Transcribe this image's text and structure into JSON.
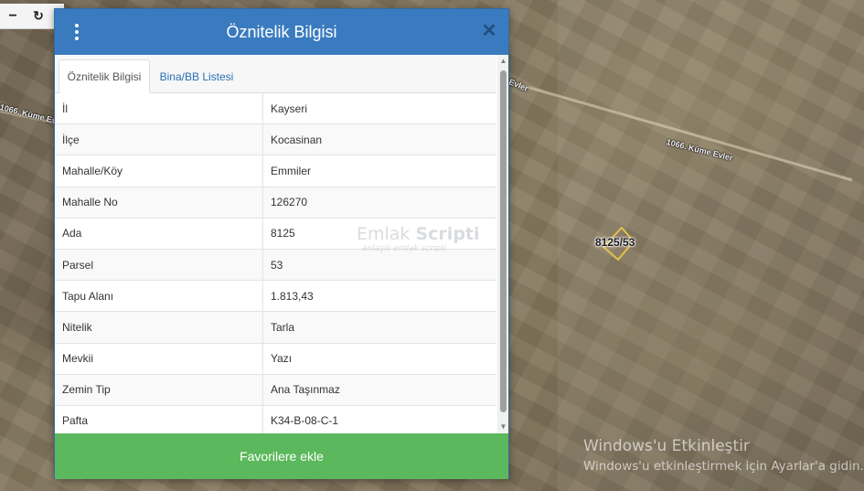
{
  "map": {
    "roads": [
      "1066. Küme Evler",
      "1066. Küme Evler",
      "Evler"
    ],
    "parcel_label": "8125/53"
  },
  "toolbar": {
    "zoom_out_icon": "minus-icon",
    "refresh_icon": "refresh-icon"
  },
  "modal": {
    "title": "Öznitelik Bilgisi",
    "tabs": [
      {
        "label": "Öznitelik Bilgisi",
        "active": true
      },
      {
        "label": "Bina/BB Listesi",
        "active": false
      }
    ],
    "rows": [
      {
        "key": "İl",
        "value": "Kayseri"
      },
      {
        "key": "İlçe",
        "value": "Kocasinan"
      },
      {
        "key": "Mahalle/Köy",
        "value": "Emmiler"
      },
      {
        "key": "Mahalle No",
        "value": "126270"
      },
      {
        "key": "Ada",
        "value": "8125"
      },
      {
        "key": "Parsel",
        "value": "53"
      },
      {
        "key": "Tapu Alanı",
        "value": "1.813,43"
      },
      {
        "key": "Nitelik",
        "value": "Tarla"
      },
      {
        "key": "Mevkii",
        "value": "Yazı"
      },
      {
        "key": "Zemin Tip",
        "value": "Ana Taşınmaz"
      },
      {
        "key": "Pafta",
        "value": "K34-B-08-C-1"
      }
    ],
    "favorite_button": "Favorilere ekle",
    "brand_watermark": {
      "title_plain": "Emlak ",
      "title_bold": "Scripti",
      "subtitle": "anlaşılı emlak scripti"
    }
  },
  "os_watermark": {
    "title": "Windows'u Etkinleştir",
    "subtitle": "Windows'u etkinleştirmek için Ayarlar'a gidin."
  },
  "colors": {
    "header": "#3a7bbf",
    "favorite_button": "#5cb85c",
    "tab_link": "#2a6fb3"
  }
}
